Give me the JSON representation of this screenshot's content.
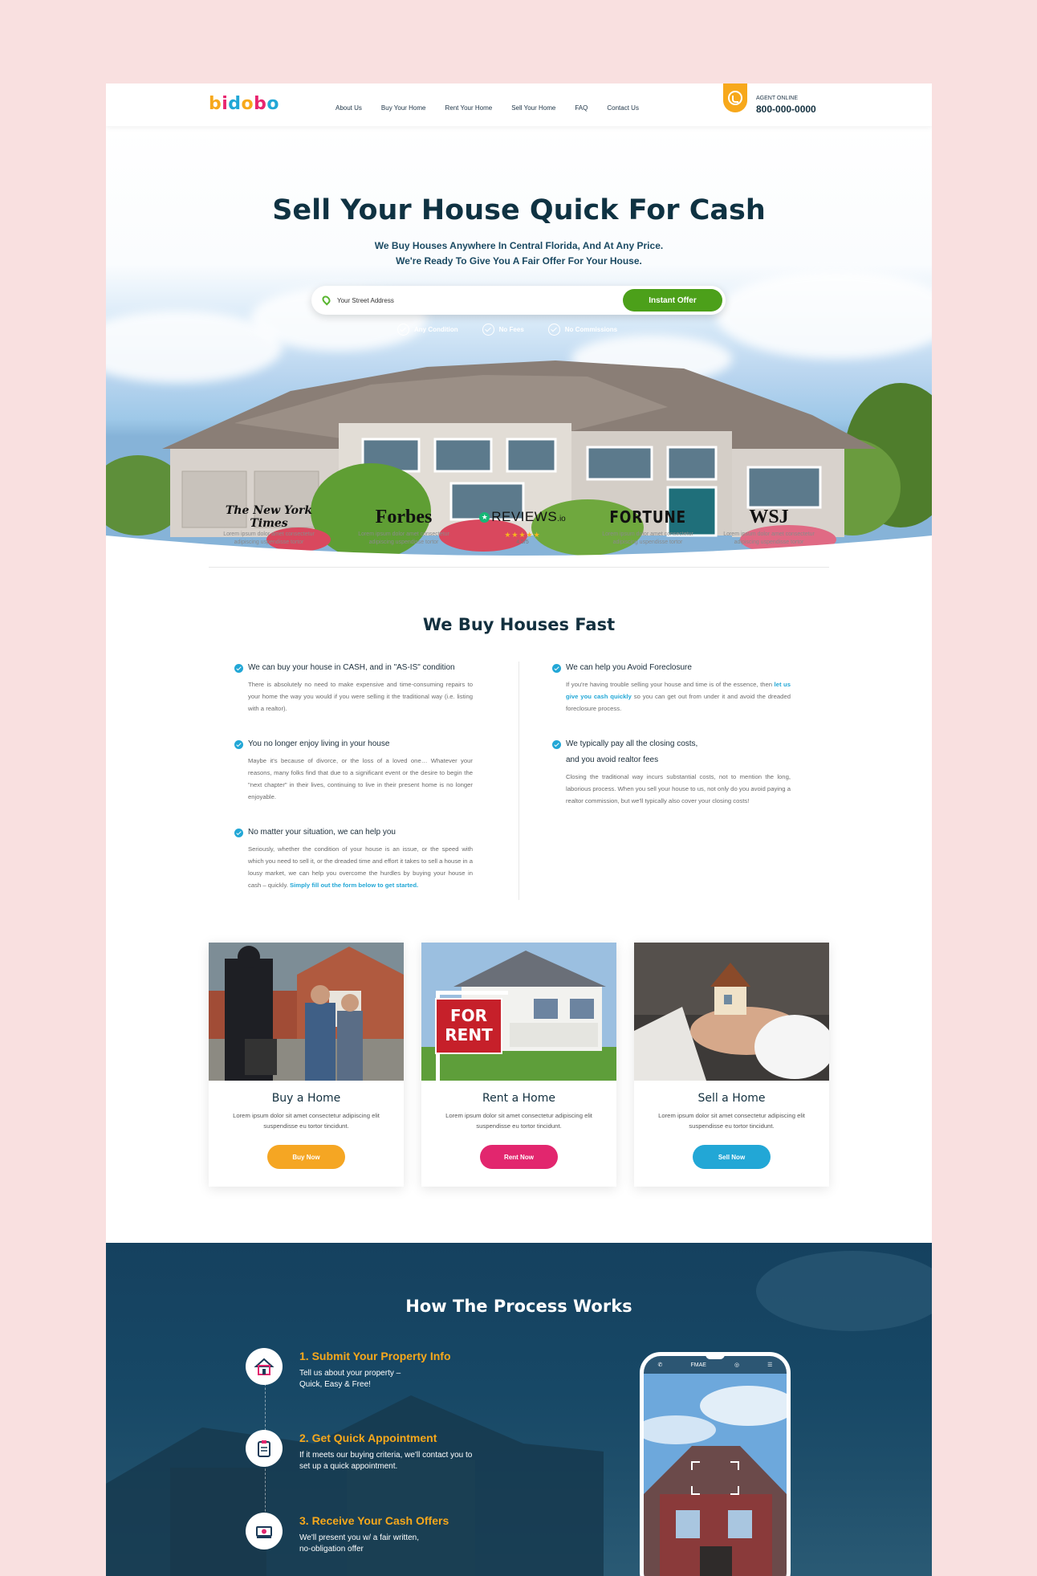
{
  "header": {
    "logo": {
      "letters": [
        "b",
        "i",
        "d",
        "o",
        "b",
        "o"
      ],
      "colors": [
        "#f7a81b",
        "#e8256f",
        "#22a7d6",
        "#f7a81b",
        "#e8256f",
        "#22a7d6"
      ]
    },
    "nav": [
      "About Us",
      "Buy Your Home",
      "Rent Your Home",
      "Sell Your Home",
      "FAQ",
      "Contact Us"
    ],
    "agent_label": "AGENT ONLINE",
    "phone": "800-000-0000"
  },
  "hero": {
    "title": "Sell Your House Quick For Cash",
    "subtitle_line1": "We Buy Houses Anywhere In Central Florida, And At Any Price.",
    "subtitle_line2": "We're Ready To Give You A Fair Offer For Your House.",
    "search_placeholder": "Your Street Address",
    "cta": "Instant Offer",
    "features": [
      "Any Condition",
      "No Fees",
      "No Commissions"
    ]
  },
  "media": {
    "items": [
      {
        "name": "The New York Times",
        "caption_line1": "Lorem ipsum dolor amet consectetur",
        "caption_line2": "adipiscing uspendisse tortor"
      },
      {
        "name": "Forbes",
        "caption_line1": "Lorem ipsum dolor amet consectetur",
        "caption_line2": "adipiscing uspendisse tortor"
      },
      {
        "name": "REVIEWS",
        "suffix": ".io",
        "stars": "★★★★★",
        "rating": "4.5/5"
      },
      {
        "name": "FORTUNE",
        "caption_line1": "Lorem ipsum dolor amet consectetur",
        "caption_line2": "adipiscing uspendisse tortor"
      },
      {
        "name": "WSJ",
        "caption_line1": "Lorem ipsum dolor amet consectetur",
        "caption_line2": "adipiscing uspendisse tortor"
      }
    ]
  },
  "why": {
    "title": "We Buy Houses Fast",
    "left": [
      {
        "heading": "We can buy your house in CASH, and in \"AS-IS\" condition",
        "body": "There is absolutely no need to make expensive and time-consuming repairs to your home the way you would if you were selling it the traditional way (i.e. listing with a realtor)."
      },
      {
        "heading": "You no longer enjoy living in your house",
        "body": "Maybe it's because of divorce, or the loss of a loved one… Whatever your reasons, many folks find that due to a significant event or the desire to begin the \"next chapter\" in their lives, continuing to live in their present home is no longer enjoyable."
      },
      {
        "heading": "No matter your situation, we can help you",
        "body": "Seriously, whether the condition of your house is an issue, or the speed with which you need to sell it, or the dreaded time and effort it takes to sell a house in a lousy market, we can help you overcome the hurdles by buying your house in cash – quickly.",
        "link": "Simply fill out the form below to get started."
      }
    ],
    "right": [
      {
        "heading": "We can help you Avoid Foreclosure",
        "body_before": "If you're having trouble selling your house and time is of the essence, then",
        "link": "let us give you cash quickly",
        "body_after": "so you can get out from under it and avoid the dreaded foreclosure process."
      },
      {
        "heading_line1": "We typically pay all the closing costs,",
        "heading_line2": "and you avoid realtor fees",
        "body": "Closing the traditional way incurs substantial costs, not to mention the long, laborious process. When you sell your house to us, not only do you avoid paying a realtor commission, but we'll typically also cover your closing costs!"
      }
    ]
  },
  "cards": [
    {
      "title": "Buy a Home",
      "text": "Lorem ipsum dolor sit amet consectetur adipiscing elit suspendisse eu tortor tincidunt.",
      "button": "Buy Now",
      "color": "#f5a623"
    },
    {
      "title": "Rent a Home",
      "text": "Lorem ipsum dolor sit amet consectetur adipiscing elit suspendisse eu tortor tincidunt.",
      "button": "Rent Now",
      "color": "#e2266e",
      "sign_line1": "FOR",
      "sign_line2": "RENT"
    },
    {
      "title": "Sell a Home",
      "text": "Lorem ipsum dolor sit amet consectetur adipiscing elit suspendisse eu tortor tincidunt.",
      "button": "Sell Now",
      "color": "#22a7d6"
    }
  ],
  "process": {
    "title": "How The Process Works",
    "steps": [
      {
        "title": "1. Submit Your Property Info",
        "line1": "Tell us about your property –",
        "line2": "Quick, Easy & Free!",
        "icon": "house-form-icon"
      },
      {
        "title": "2. Get Quick Appointment",
        "line1": "If it meets our buying criteria, we'll contact you to",
        "line2": "set up a quick appointment.",
        "icon": "clipboard-icon"
      },
      {
        "title": "3. Receive Your Cash Offers",
        "line1": "We'll present you w/ a fair written,",
        "line2": "no-obligation offer",
        "icon": "cash-offer-icon"
      }
    ],
    "phone_app": {
      "brand": "FMAE"
    }
  }
}
